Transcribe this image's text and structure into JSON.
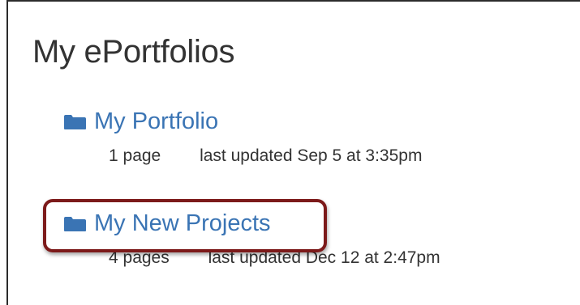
{
  "page": {
    "title": "My ePortfolios"
  },
  "portfolios": [
    {
      "name": "My Portfolio",
      "pages": "1 page",
      "updated": "last updated Sep 5 at 3:35pm"
    },
    {
      "name": "My New Projects",
      "pages": "4 pages",
      "updated": "last updated Dec 12 at 2:47pm"
    }
  ],
  "colors": {
    "link": "#3a74b4",
    "highlight": "#7c1a1a",
    "text": "#333333"
  },
  "icons": [
    "folder-icon"
  ]
}
